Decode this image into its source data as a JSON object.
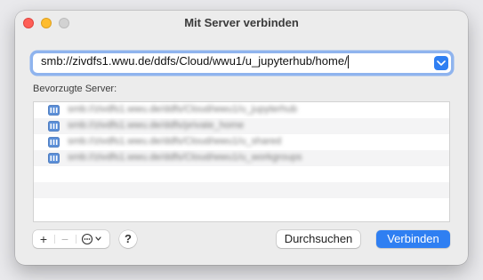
{
  "window": {
    "title": "Mit Server verbinden"
  },
  "server_address": {
    "value": "smb://zivdfs1.wwu.de/ddfs/Cloud/wwu1/u_jupyterhub/home/"
  },
  "favorites": {
    "label": "Bevorzugte Server:",
    "items": [
      {
        "icon": "network-server-icon",
        "text": "smb://zivdfs1.wwu.de/ddfs/Cloud/wwu1/u_jupyterhub"
      },
      {
        "icon": "network-server-icon",
        "text": "smb://zivdfs1.wwu.de/ddfs/private_home"
      },
      {
        "icon": "network-server-icon",
        "text": "smb://zivdfs1.wwu.de/ddfs/Cloud/wwu1/u_shared"
      },
      {
        "icon": "network-server-icon",
        "text": "smb://zivdfs1.wwu.de/ddfs/Cloud/wwu1/u_workgroups"
      }
    ]
  },
  "toolbar": {
    "add_label": "+",
    "remove_label": "−",
    "action_icon": "ellipsis-circle-icon",
    "help_label": "?"
  },
  "buttons": {
    "browse_label": "Durchsuchen",
    "connect_label": "Verbinden"
  },
  "colors": {
    "accent": "#2f7ff2",
    "close": "#ff5f57",
    "minimize": "#febc2e",
    "maximize": "#d2d2d2"
  }
}
